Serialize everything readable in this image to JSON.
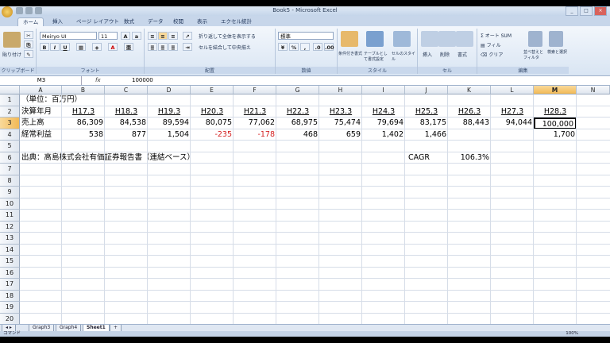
{
  "window": {
    "title": "Book5 - Microsoft Excel"
  },
  "tabs": [
    "ホーム",
    "挿入",
    "ページ レイアウト",
    "数式",
    "データ",
    "校閲",
    "表示",
    "エクセル統計"
  ],
  "ribbon": {
    "font_name": "Meiryo UI",
    "font_size": "11",
    "paste_label": "貼り付け",
    "wrap_label": "折り返して全体を表示する",
    "merge_label": "セルを結合して中央揃え",
    "number_format": "標準",
    "cond_format": "条件付き書式",
    "table_format": "テーブルとして書式設定",
    "cell_style": "セルのスタイル",
    "insert": "挿入",
    "delete": "削除",
    "format": "書式",
    "autosum": "オート SUM",
    "fill": "フィル",
    "clear": "クリア",
    "sort_filter": "並べ替えとフィルタ",
    "find_select": "検索と選択",
    "groups": [
      "クリップボード",
      "フォント",
      "配置",
      "数値",
      "スタイル",
      "セル",
      "編集"
    ]
  },
  "formula_bar": {
    "name_box": "M3",
    "fx": "fx",
    "value": "100000"
  },
  "columns": [
    "A",
    "B",
    "C",
    "D",
    "E",
    "F",
    "G",
    "H",
    "I",
    "J",
    "K",
    "L",
    "M",
    "N"
  ],
  "rows": [
    "1",
    "2",
    "3",
    "4",
    "5",
    "6",
    "7",
    "8",
    "9",
    "10",
    "11",
    "12",
    "13",
    "14",
    "15",
    "16",
    "17",
    "18",
    "19",
    "20"
  ],
  "cells": {
    "A1": "（単位：百万円）",
    "A2": "決算年月",
    "A3": "売上高",
    "A4": "経常利益",
    "A6": "出典：高島株式会社有価証券報告書（連結ベース）",
    "J6": "CAGR",
    "K6": "106.3%",
    "headers": [
      "H17.3",
      "H18.3",
      "H19.3",
      "H20.3",
      "H21.3",
      "H22.3",
      "H23.3",
      "H24.3",
      "H25.3",
      "H26.3",
      "H27.3",
      "H28.3"
    ],
    "sales": [
      "86,309",
      "84,538",
      "89,594",
      "80,075",
      "77,062",
      "68,975",
      "75,474",
      "79,694",
      "83,175",
      "88,443",
      "94,044",
      "100,000"
    ],
    "profit": [
      "538",
      "877",
      "1,504",
      "-235",
      "-178",
      "468",
      "659",
      "1,402",
      "1,466",
      "",
      "",
      "1,700"
    ]
  },
  "sheets": [
    "Graph3",
    "Graph4",
    "Sheet1"
  ],
  "status": "コマンド",
  "zoom": "100%",
  "colors": {
    "accent": "#f2b955",
    "negative": "#d42020"
  }
}
